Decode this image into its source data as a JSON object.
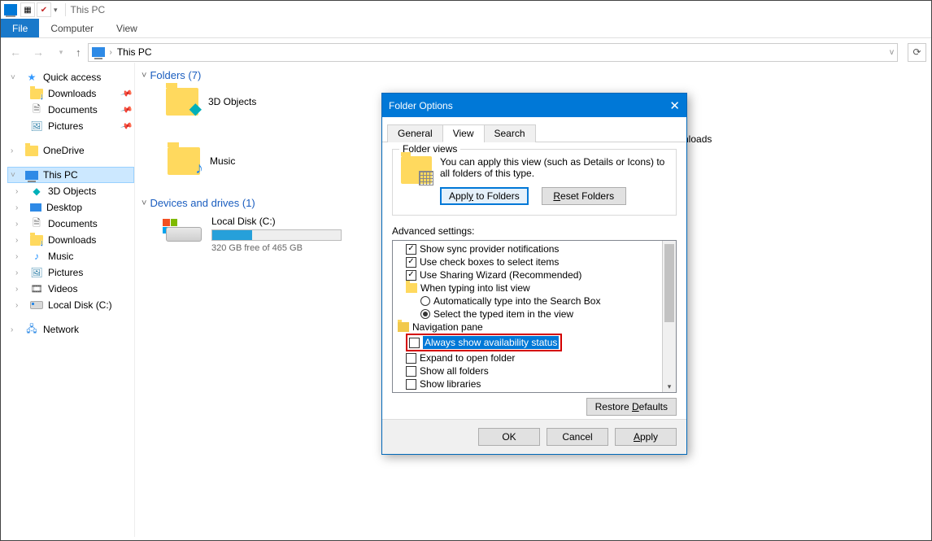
{
  "titlebar": {
    "title": "This PC"
  },
  "ribbon": {
    "file": "File",
    "computer": "Computer",
    "view": "View"
  },
  "address": {
    "location": "This PC",
    "dropdown_state": "v"
  },
  "sidebar": {
    "quick_access": "Quick access",
    "qa_items": [
      {
        "label": "Downloads"
      },
      {
        "label": "Documents"
      },
      {
        "label": "Pictures"
      }
    ],
    "onedrive": "OneDrive",
    "this_pc": "This PC",
    "pc_items": [
      {
        "label": "3D Objects"
      },
      {
        "label": "Desktop"
      },
      {
        "label": "Documents"
      },
      {
        "label": "Downloads"
      },
      {
        "label": "Music"
      },
      {
        "label": "Pictures"
      },
      {
        "label": "Videos"
      },
      {
        "label": "Local Disk (C:)"
      }
    ],
    "network": "Network"
  },
  "main": {
    "folders_header": "Folders (7)",
    "folders": [
      {
        "label": "3D Objects"
      },
      {
        "label": "Music"
      },
      {
        "label": "Downloads"
      }
    ],
    "drives_header": "Devices and drives (1)",
    "drive": {
      "label": "Local Disk (C:)",
      "free_text": "320 GB free of 465 GB",
      "used_pct": 31
    }
  },
  "dialog": {
    "title": "Folder Options",
    "tabs": {
      "general": "General",
      "view": "View",
      "search": "Search"
    },
    "folder_views": {
      "legend": "Folder views",
      "desc": "You can apply this view (such as Details or Icons) to all folders of this type.",
      "apply": "Apply to Folders",
      "reset": "Reset Folders"
    },
    "advanced_label": "Advanced settings:",
    "adv": {
      "sync": "Show sync provider notifications",
      "checkboxes": "Use check boxes to select items",
      "sharing": "Use Sharing Wizard (Recommended)",
      "typing_group": "When typing into list view",
      "type_search": "Automatically type into the Search Box",
      "type_select": "Select the typed item in the view",
      "nav_group": "Navigation pane",
      "avail": "Always show availability status",
      "expand": "Expand to open folder",
      "showall": "Show all folders",
      "showlib": "Show libraries"
    },
    "restore": "Restore Defaults",
    "ok": "OK",
    "cancel": "Cancel",
    "apply": "Apply"
  }
}
